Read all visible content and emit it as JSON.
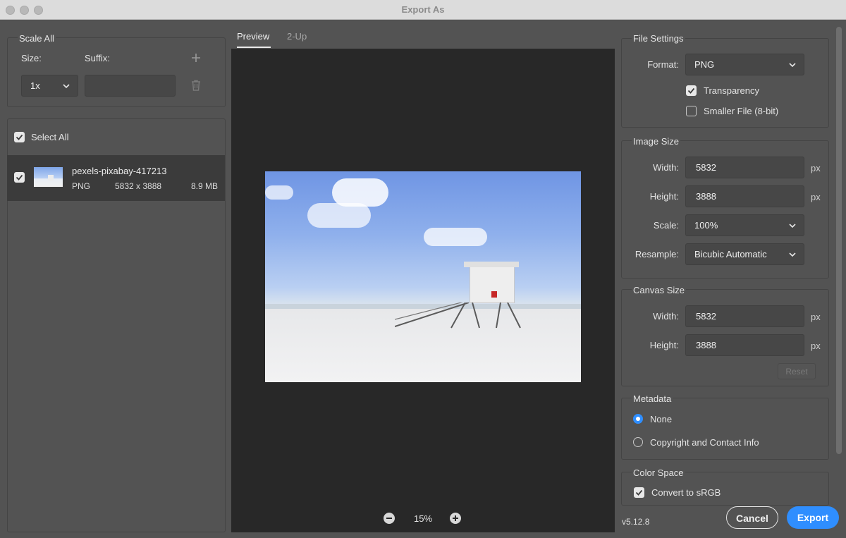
{
  "window": {
    "title": "Export As"
  },
  "scale_all": {
    "section_title": "Scale All",
    "size_label": "Size:",
    "suffix_label": "Suffix:",
    "size_value": "1x",
    "suffix_value": ""
  },
  "file_list": {
    "select_all_label": "Select All",
    "items": [
      {
        "name": "pexels-pixabay-417213",
        "format": "PNG",
        "dimensions": "5832 x 3888",
        "size": "8.9 MB"
      }
    ]
  },
  "preview": {
    "tabs": [
      {
        "label": "Preview"
      },
      {
        "label": "2-Up"
      }
    ],
    "zoom": "15%"
  },
  "file_settings": {
    "section_title": "File Settings",
    "format_label": "Format:",
    "format_value": "PNG",
    "transparency_label": "Transparency",
    "transparency_checked": true,
    "smaller_file_label": "Smaller File (8-bit)",
    "smaller_file_checked": false
  },
  "image_size": {
    "section_title": "Image Size",
    "width_label": "Width:",
    "width_value": "5832",
    "height_label": "Height:",
    "height_value": "3888",
    "scale_label": "Scale:",
    "scale_value": "100%",
    "resample_label": "Resample:",
    "resample_value": "Bicubic Automatic",
    "unit": "px"
  },
  "canvas_size": {
    "section_title": "Canvas Size",
    "width_label": "Width:",
    "width_value": "5832",
    "height_label": "Height:",
    "height_value": "3888",
    "unit": "px",
    "reset_label": "Reset"
  },
  "metadata": {
    "section_title": "Metadata",
    "options": [
      {
        "label": "None",
        "selected": true
      },
      {
        "label": "Copyright and Contact Info",
        "selected": false
      }
    ]
  },
  "color_space": {
    "section_title": "Color Space",
    "convert_label": "Convert to sRGB",
    "convert_checked": true
  },
  "footer": {
    "version": "v5.12.8",
    "cancel_label": "Cancel",
    "export_label": "Export"
  },
  "colors": {
    "accent": "#2f8eff",
    "panel_bg": "#535353",
    "preview_bg": "#282828"
  }
}
